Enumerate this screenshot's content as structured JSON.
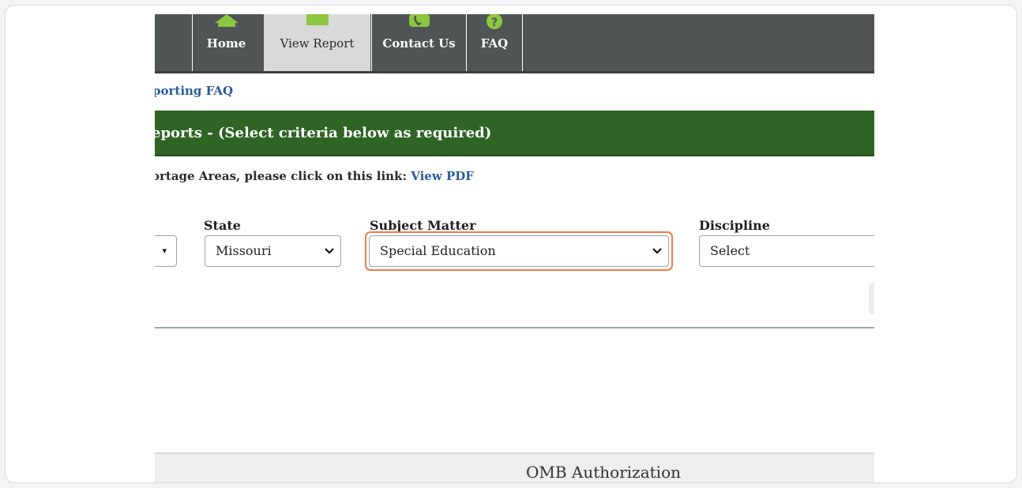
{
  "nav": {
    "items": [
      {
        "label": "Home",
        "icon": "home-icon"
      },
      {
        "label": "View Report",
        "icon": "report-icon"
      },
      {
        "label": "Contact Us",
        "icon": "phone-icon"
      },
      {
        "label": "FAQ",
        "icon": "question-icon"
      }
    ],
    "icon_color": "#8dc63f"
  },
  "breadcrumb": "porting FAQ",
  "banner": {
    "title": "eports - (Select criteria below as required)",
    "color": "#2e6424"
  },
  "instruction": {
    "text": "ortage Areas, please click on this link: ",
    "link": "View PDF"
  },
  "filters": {
    "state": {
      "label": "State",
      "value": "Missouri"
    },
    "subject": {
      "label": "Subject Matter",
      "value": "Special Education"
    },
    "discipline": {
      "label": "Discipline",
      "value": "Select"
    }
  },
  "highlight_color": "#f07b4a",
  "footer": "OMB Authorization"
}
